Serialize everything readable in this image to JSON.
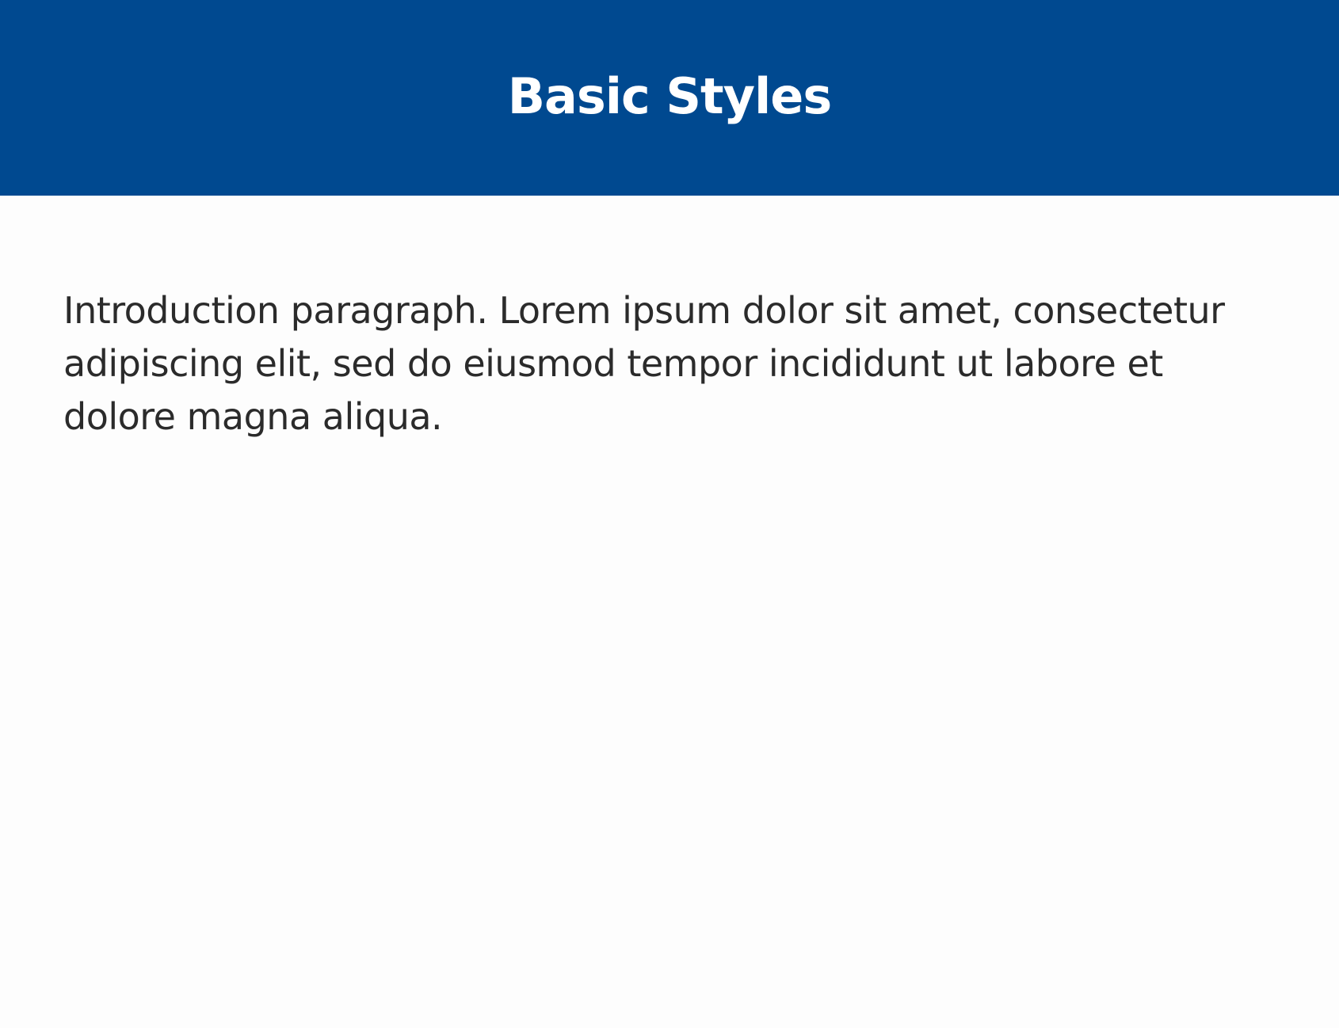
{
  "header": {
    "title": "Basic Styles",
    "background_color": "#004990",
    "text_color": "#ffffff"
  },
  "main": {
    "intro_paragraph": "Introduction paragraph. Lorem ipsum dolor sit amet, consectetur adipiscing elit, sed do eiusmod tempor incididunt ut labore et dolore magna aliqua.",
    "text_color": "#2b2b2b",
    "background_color": "#fdfdfd"
  }
}
